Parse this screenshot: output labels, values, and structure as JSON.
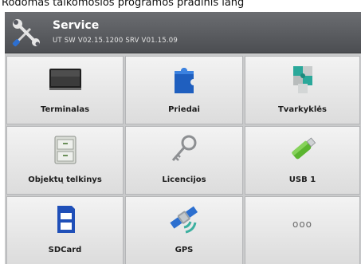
{
  "caption": "Rodomas taikomosios programos pradinis lang",
  "header": {
    "title": "Service",
    "subtitle": "UT SW V02.15.1200 SRV V01.15.09",
    "icon": "tools-icon"
  },
  "tiles": [
    {
      "label": "Terminalas",
      "icon": "terminal-icon"
    },
    {
      "label": "Priedai",
      "icon": "puzzle-piece-icon"
    },
    {
      "label": "Tvarkyklės",
      "icon": "drivers-icon"
    },
    {
      "label": "Objektų telkinys",
      "icon": "file-cabinet-icon"
    },
    {
      "label": "Licencijos",
      "icon": "key-icon"
    },
    {
      "label": "USB 1",
      "icon": "usb-stick-icon"
    },
    {
      "label": "SDCard",
      "icon": "sd-card-icon"
    },
    {
      "label": "GPS",
      "icon": "satellite-icon"
    },
    {
      "label": "ooo",
      "icon": "more-icon"
    }
  ],
  "colors": {
    "header_bg": "#5a5c60",
    "tile_bg": "#e9e9e9",
    "accent_blue": "#1f5fbf",
    "usb_green": "#5bb530"
  }
}
